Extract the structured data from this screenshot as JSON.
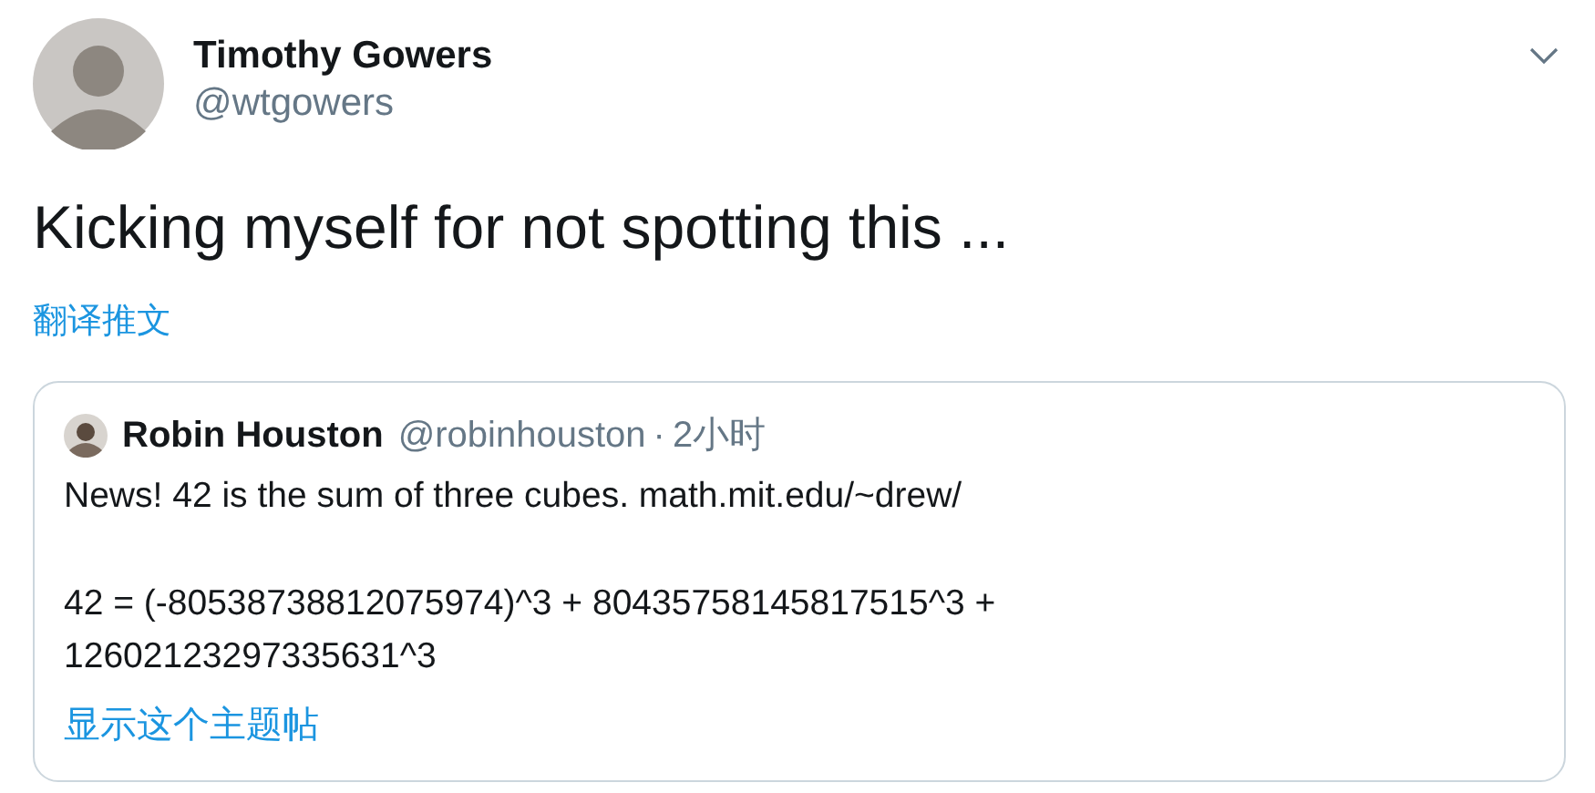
{
  "author": {
    "name": "Timothy Gowers",
    "handle": "@wtgowers"
  },
  "tweet_text": "Kicking myself for not spotting this ...",
  "translate_link": "翻译推文",
  "quoted_tweet": {
    "author": {
      "name": "Robin Houston",
      "handle": "@robinhouston"
    },
    "separator": "·",
    "time": "2小时",
    "paragraphs": [
      "News! 42 is the sum of three cubes. math.mit.edu/~drew/",
      "42 = (-80538738812075974)^3 + 80435758145817515^3 +\n12602123297335631^3"
    ],
    "show_thread_link": "显示这个主题帖"
  }
}
